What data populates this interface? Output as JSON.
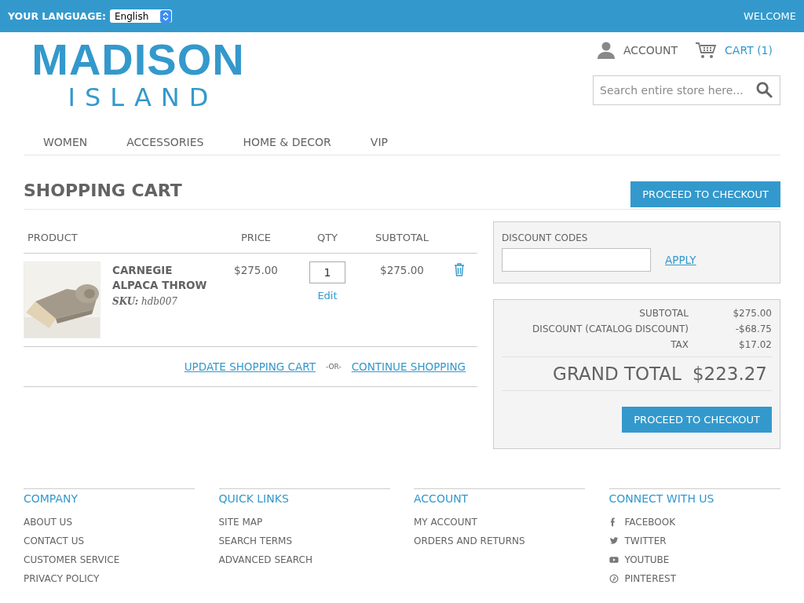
{
  "top_bar": {
    "language_label": "YOUR LANGUAGE:",
    "language": "English",
    "welcome": "WELCOME"
  },
  "logo": {
    "line_1": "MADISON",
    "line_2": "ISLAND"
  },
  "account_link": "ACCOUNT",
  "cart_link": "CART (1)",
  "search": {
    "placeholder": "Search entire store here..."
  },
  "nav": [
    "WOMEN",
    "ACCESSORIES",
    "HOME & DECOR",
    "VIP"
  ],
  "page_title": "SHOPPING CART",
  "checkout_button_top": "PROCEED TO CHECKOUT",
  "cart": {
    "columns": [
      "PRODUCT",
      "PRICE",
      "QTY",
      "SUBTOTAL"
    ],
    "rows": [
      {
        "name": "CARNEGIE ALPACA THROW",
        "sku_label": "SKU:",
        "sku": "hdb007",
        "price": "$275.00",
        "qty": "1",
        "edit": "Edit",
        "subtotal": "$275.00"
      }
    ],
    "update_link": "UPDATE SHOPPING CART",
    "separator": "-OR-",
    "continue_link": "CONTINUE SHOPPING"
  },
  "discount": {
    "title": "DISCOUNT CODES",
    "apply": "APPLY"
  },
  "totals": {
    "lines": [
      {
        "label": "SUBTOTAL",
        "value": "$275.00"
      },
      {
        "label": "DISCOUNT (CATALOG DISCOUNT)",
        "value": "-$68.75"
      },
      {
        "label": "TAX",
        "value": "$17.02"
      }
    ],
    "grand_total_label": "GRAND TOTAL",
    "grand_total": "$223.27",
    "checkout_button": "PROCEED TO CHECKOUT"
  },
  "footer": [
    {
      "title": "COMPANY",
      "links": [
        {
          "label": "ABOUT US"
        },
        {
          "label": "CONTACT US"
        },
        {
          "label": "CUSTOMER SERVICE"
        },
        {
          "label": "PRIVACY POLICY"
        }
      ]
    },
    {
      "title": "QUICK LINKS",
      "links": [
        {
          "label": "SITE MAP"
        },
        {
          "label": "SEARCH TERMS"
        },
        {
          "label": "ADVANCED SEARCH"
        }
      ]
    },
    {
      "title": "ACCOUNT",
      "links": [
        {
          "label": "MY ACCOUNT"
        },
        {
          "label": "ORDERS AND RETURNS"
        }
      ]
    },
    {
      "title": "CONNECT WITH US",
      "links": [
        {
          "label": "FACEBOOK",
          "kind": "facebook"
        },
        {
          "label": "TWITTER",
          "kind": "twitter"
        },
        {
          "label": "YOUTUBE",
          "kind": "youtube"
        },
        {
          "label": "PINTEREST",
          "kind": "pinterest"
        }
      ]
    }
  ]
}
